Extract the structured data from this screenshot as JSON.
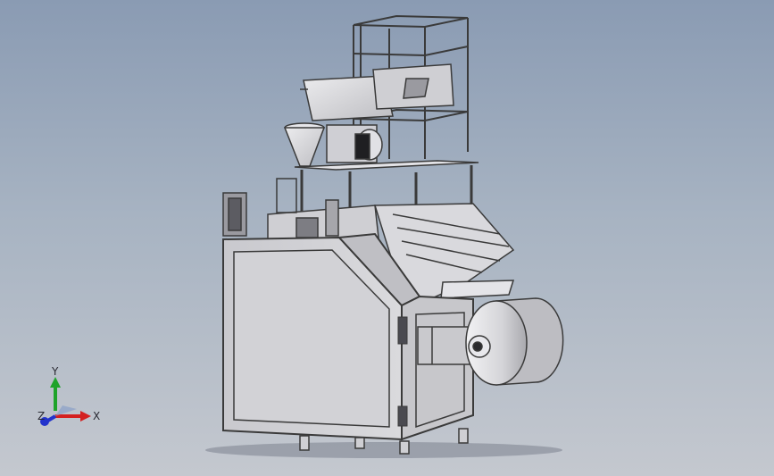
{
  "viewport": {
    "background_top": "#8a9bb3",
    "background_bottom": "#c4c8cf",
    "model_color": "#d6d6d9",
    "edge_color": "#3a3a3a"
  },
  "triad": {
    "x_label": "X",
    "y_label": "Y",
    "z_label": "Z",
    "x_color": "#d42020",
    "y_color": "#1ea32a",
    "z_color": "#2233cc"
  }
}
